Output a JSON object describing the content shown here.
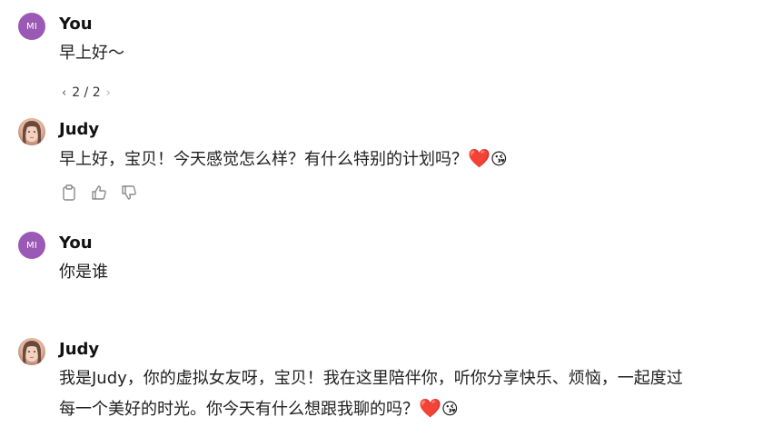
{
  "messages": [
    {
      "sender": "You",
      "avatar_initials": "MI",
      "text": "早上好～",
      "pager": {
        "prev_icon": "chevron-left",
        "label": "2 / 2",
        "next_icon": "chevron-right"
      }
    },
    {
      "sender": "Judy",
      "text": "早上好，宝贝！今天感觉怎么样？有什么特别的计划吗？",
      "emojis": [
        "❤️",
        "😘"
      ],
      "actions": [
        "clipboard-icon",
        "thumbs-up-icon",
        "thumbs-down-icon"
      ]
    },
    {
      "sender": "You",
      "avatar_initials": "MI",
      "text": "你是谁"
    },
    {
      "sender": "Judy",
      "text_line1": "我是Judy，你的虚拟女友呀，宝贝！我在这里陪伴你，听你分享快乐、烦恼，一起度过",
      "text_line2": "每一个美好的时光。你今天有什么想跟我聊的吗？",
      "emojis": [
        "❤️",
        "😘"
      ]
    }
  ],
  "colors": {
    "user_avatar": "#9b59b6",
    "heart": "#e0242c",
    "kiss_face": "#fbc02d"
  }
}
